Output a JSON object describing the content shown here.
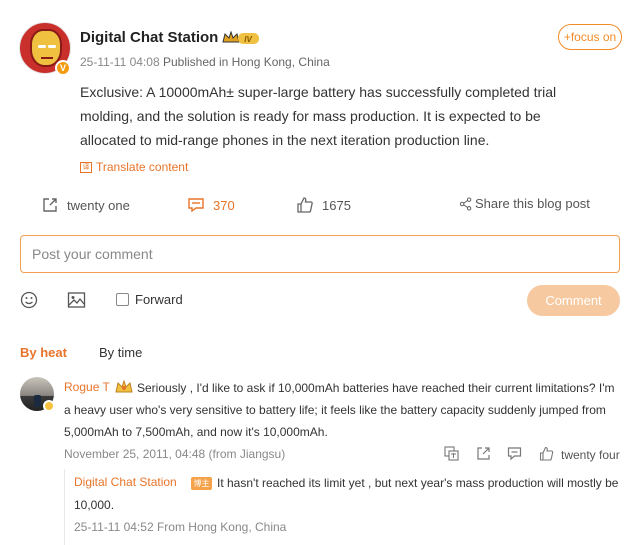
{
  "post": {
    "author": "Digital Chat Station",
    "level_badge": "IV",
    "verified_badge": "V",
    "timestamp": "25-11-11 04:08",
    "published_in": "Published in Hong Kong, China",
    "follow_label": "+focus on",
    "content": "Exclusive: A 10000mAh± super-large battery has successfully completed trial molding, and the solution is ready for mass production. It is expected to be allocated to mid-range phones in the next iteration production line.",
    "translate_label": "Translate content",
    "translate_icon_text": "译",
    "forward_count": "twenty one",
    "comment_count": "370",
    "like_count": "1675",
    "share_label": "Share this blog post"
  },
  "composer": {
    "placeholder": "Post your comment",
    "forward_label": "Forward",
    "submit_label": "Comment"
  },
  "sort": {
    "by_heat": "By heat",
    "by_time": "By time"
  },
  "comment": {
    "user": "Rogue T",
    "text": "Seriously , I'd like to ask if 10,000mAh batteries have reached their current limitations? I'm a heavy user who's very sensitive to battery life; it feels like the battery capacity suddenly jumped from 5,000mAh to 7,500mAh, and now it's 10,000mAh.",
    "meta": "November 25, 2011, 04:48 (from Jiangsu)",
    "like_count": "twenty four"
  },
  "reply": {
    "user": "Digital Chat Station",
    "tag": "博主",
    "text": "It hasn't reached its limit yet , but next year's mass production will mostly be 10,000.",
    "meta": "25-11-11 04:52 From Hong Kong, China"
  },
  "colors": {
    "accent": "#e8742a",
    "submit_disabled": "#f6c9a0"
  }
}
